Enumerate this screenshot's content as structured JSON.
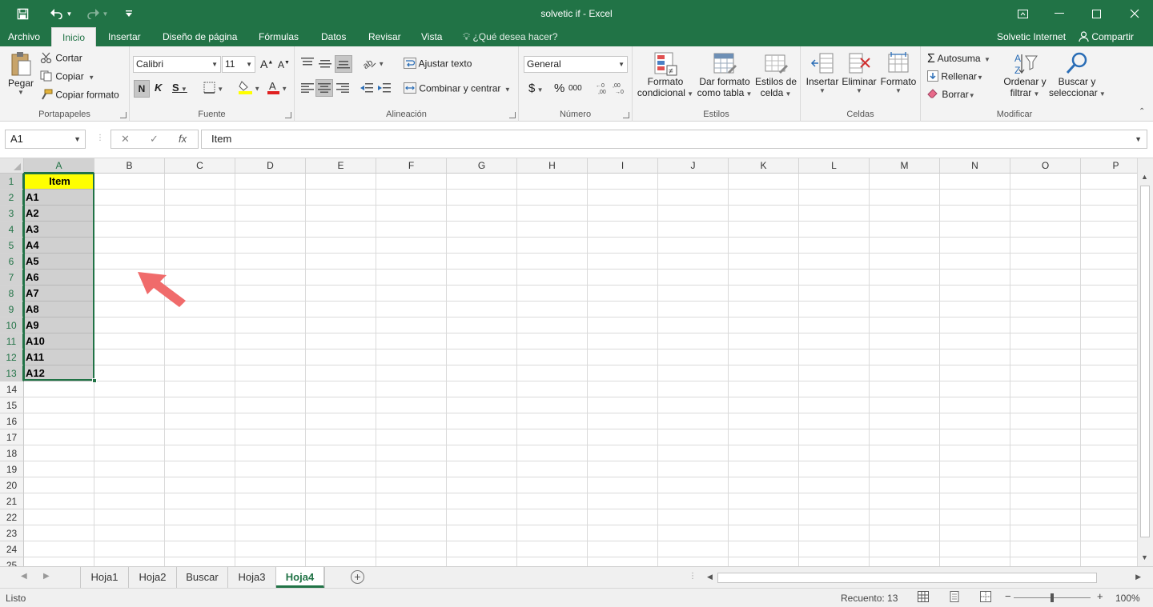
{
  "window": {
    "title": "solvetic if - Excel",
    "theme_color": "#217346"
  },
  "quick_access": [
    {
      "name": "save-icon"
    },
    {
      "name": "undo-icon"
    },
    {
      "name": "redo-icon"
    },
    {
      "name": "customize-qat-icon"
    }
  ],
  "tabs": [
    "Archivo",
    "Inicio",
    "Insertar",
    "Diseño de página",
    "Fórmulas",
    "Datos",
    "Revisar",
    "Vista"
  ],
  "active_tab": "Inicio",
  "tell_me": "¿Qué desea hacer?",
  "user": "Solvetic Internet",
  "share_label": "Compartir",
  "ribbon": {
    "clipboard": {
      "label": "Portapapeles",
      "paste": "Pegar",
      "cut": "Cortar",
      "copy": "Copiar",
      "format_painter": "Copiar formato"
    },
    "font": {
      "label": "Fuente",
      "font_name": "Calibri",
      "font_size": "11",
      "bold": "N",
      "italic": "K",
      "underline": "S"
    },
    "alignment": {
      "label": "Alineación",
      "wrap_text": "Ajustar texto",
      "merge_center": "Combinar y centrar"
    },
    "number": {
      "label": "Número",
      "format": "General",
      "currency": "$",
      "percent": "%",
      "thousands": "000"
    },
    "styles": {
      "label": "Estilos",
      "conditional_1": "Formato",
      "conditional_2": "condicional",
      "table_1": "Dar formato",
      "table_2": "como tabla",
      "cell_1": "Estilos de",
      "cell_2": "celda"
    },
    "cells": {
      "label": "Celdas",
      "insert": "Insertar",
      "delete": "Eliminar",
      "format": "Formato"
    },
    "editing": {
      "label": "Modificar",
      "autosum": "Autosuma",
      "fill": "Rellenar",
      "clear": "Borrar",
      "sort_1": "Ordenar y",
      "sort_2": "filtrar",
      "find_1": "Buscar y",
      "find_2": "seleccionar"
    }
  },
  "formula_bar": {
    "name_box": "A1",
    "fx": "fx",
    "content": "Item"
  },
  "columns": [
    "A",
    "B",
    "C",
    "D",
    "E",
    "F",
    "G",
    "H",
    "I",
    "J",
    "K",
    "L",
    "M",
    "N",
    "O",
    "P"
  ],
  "rows": [
    "1",
    "2",
    "3",
    "4",
    "5",
    "6",
    "7",
    "8",
    "9",
    "10",
    "11",
    "12",
    "13",
    "14",
    "15",
    "16",
    "17",
    "18",
    "19",
    "20",
    "21",
    "22",
    "23",
    "24",
    "25"
  ],
  "cells": {
    "column_a": [
      "Item",
      "A1",
      "A2",
      "A3",
      "A4",
      "A5",
      "A6",
      "A7",
      "A8",
      "A9",
      "A10",
      "A11",
      "A12"
    ],
    "header_fill": "#ffff00",
    "data_fill": "#d0d0d0"
  },
  "sheet_tabs": [
    "Hoja1",
    "Hoja2",
    "Buscar",
    "Hoja3",
    "Hoja4"
  ],
  "active_sheet": "Hoja4",
  "status": {
    "mode": "Listo",
    "count": "Recuento: 13",
    "zoom": "100%"
  }
}
